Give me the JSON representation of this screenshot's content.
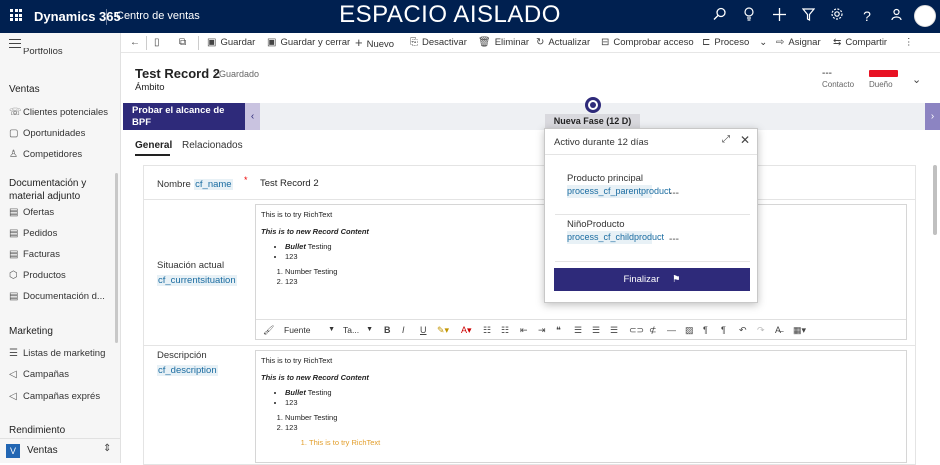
{
  "topbar": {
    "app_name": "Dynamics 365",
    "app_area": "Centro de ventas",
    "sandbox_banner": "ESPACIO AISLADO",
    "icons": [
      "search-icon",
      "lightbulb-icon",
      "plus-icon",
      "filter-icon",
      "gear-icon",
      "help-icon",
      "feedback-icon",
      "user-avatar"
    ]
  },
  "leftnav": {
    "portfolios_partial": "Portfolios",
    "section_sales": "Ventas",
    "items_sales": [
      "Clientes potenciales",
      "Oportunidades",
      "Competidores"
    ],
    "section_docs": "Documentación y material adjunto",
    "items_docs": [
      "Ofertas",
      "Pedidos",
      "Facturas",
      "Productos",
      "Documentación d..."
    ],
    "section_marketing": "Marketing",
    "items_marketing": [
      "Listas de marketing",
      "Campañas",
      "Campañas exprés"
    ],
    "section_performance": "Rendimiento",
    "area_badge": "V",
    "area_label": "Ventas"
  },
  "commands": {
    "save": "Guardar",
    "save_close": "Guardar y cerrar",
    "new": "Nuevo",
    "deactivate": "Desactivar",
    "delete": "Eliminar",
    "refresh": "Actualizar",
    "check_access": "Comprobar acceso",
    "process": "Proceso",
    "assign": "Asignar",
    "share": "Compartir"
  },
  "header": {
    "title": "Test Record 2",
    "saved": ": Guardado",
    "entity": "Ámbito",
    "contact_value": "---",
    "contact_label": "Contacto",
    "owner_label": "Dueño"
  },
  "bpf": {
    "tag_title": "Probar el alcance de BPF",
    "tag_sub": "Activo durante 12 días",
    "stage_label": "Nueva Fase  (12 D)"
  },
  "tabs": {
    "general": "General",
    "related": "Relacionados"
  },
  "form": {
    "name_label": "Nombre",
    "name_schema": "cf_name",
    "name_required": "*",
    "name_value": "Test Record 2",
    "situation_label": "Situación actual",
    "situation_schema": "cf_currentsituation",
    "description_label": "Descripción",
    "description_schema": "cf_description"
  },
  "rte": {
    "line1": "This is to try RichText",
    "line2": "This is to new Record Content",
    "bullet_bold": "Bullet",
    "bullet_rest": " Testing",
    "bullet2": "123",
    "num1": "Number Testing",
    "num2": "123",
    "orange_line": "This is to try RichText",
    "font_select": "Fuente",
    "size_select": "Ta..."
  },
  "popup": {
    "title": "Activo durante 12 días",
    "field1_label": "Producto principal",
    "field1_value": "process_cf_parentproduct",
    "field2_label": "NiñoProducto",
    "field2_value": "process_cf_childproduct",
    "dots": "---",
    "finish": "Finalizar"
  },
  "colors": {
    "topbar": "#002050",
    "bpf_accent": "#2e2a7a",
    "owner_badge": "#e81123",
    "link": "#1a6ca1"
  }
}
